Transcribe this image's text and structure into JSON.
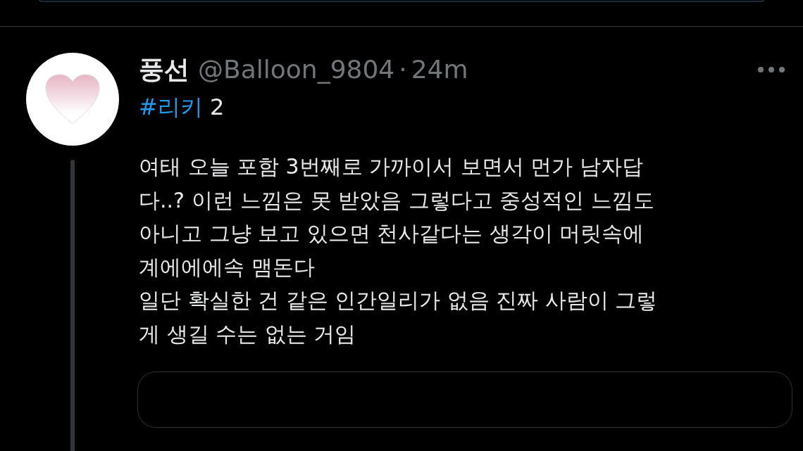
{
  "tweet": {
    "display_name": "풍선",
    "handle": "@Balloon_9804",
    "separator": "·",
    "time": "24m",
    "hashtag": "#리키",
    "after_hashtag": "2",
    "body_lines": [
      "여태 오늘 포함 3번째로 가까이서 보면서 먼가 남자답",
      "다..? 이런 느낌은 못 받았음 그렇다고 중성적인 느낌도",
      "아니고 그냥 보고 있으면 천사같다는 생각이 머릿속에",
      "계에에에속 맴돈다",
      "일단 확실한 건 같은 인간일리가 없음 진짜 사람이 그렇",
      "게 생길 수는 없는 거임"
    ],
    "thread_line": true
  }
}
